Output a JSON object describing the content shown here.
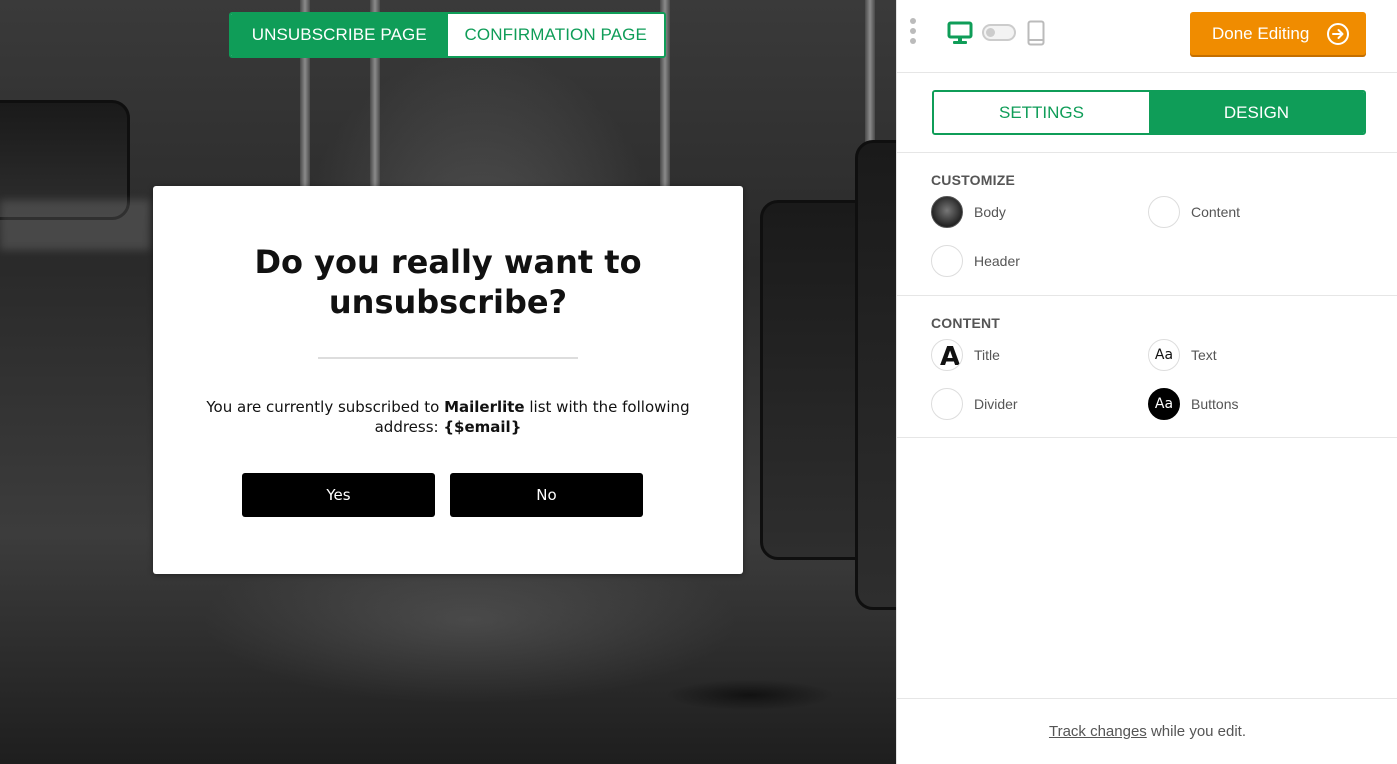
{
  "page_tabs": {
    "unsubscribe": "UNSUBSCRIBE PAGE",
    "confirmation": "CONFIRMATION PAGE"
  },
  "dialog": {
    "title": "Do you really want to unsubscribe?",
    "text_before": "You are currently subscribed to ",
    "list_name": "Mailerlite",
    "text_after": " list with the following address: ",
    "email_tag": "{$email}",
    "yes_label": "Yes",
    "no_label": "No"
  },
  "toolbar": {
    "done_label": "Done Editing",
    "icons": [
      "desktop-icon",
      "view-toggle",
      "tablet-icon",
      "arrow-right-circle-icon"
    ]
  },
  "mode_tabs": {
    "settings": "SETTINGS",
    "design": "DESIGN"
  },
  "customize": {
    "title": "CUSTOMIZE",
    "body": "Body",
    "content": "Content",
    "header": "Header"
  },
  "content_section": {
    "title": "CONTENT",
    "title_item": "Title",
    "text_item": "Text",
    "divider_item": "Divider",
    "buttons_item": "Buttons",
    "title_glyph": "A",
    "aa_glyph": "Aa"
  },
  "footer": {
    "link": "Track changes",
    "rest": " while you edit."
  },
  "colors": {
    "accent_green": "#0f9d58",
    "done_orange": "#f08c00"
  }
}
